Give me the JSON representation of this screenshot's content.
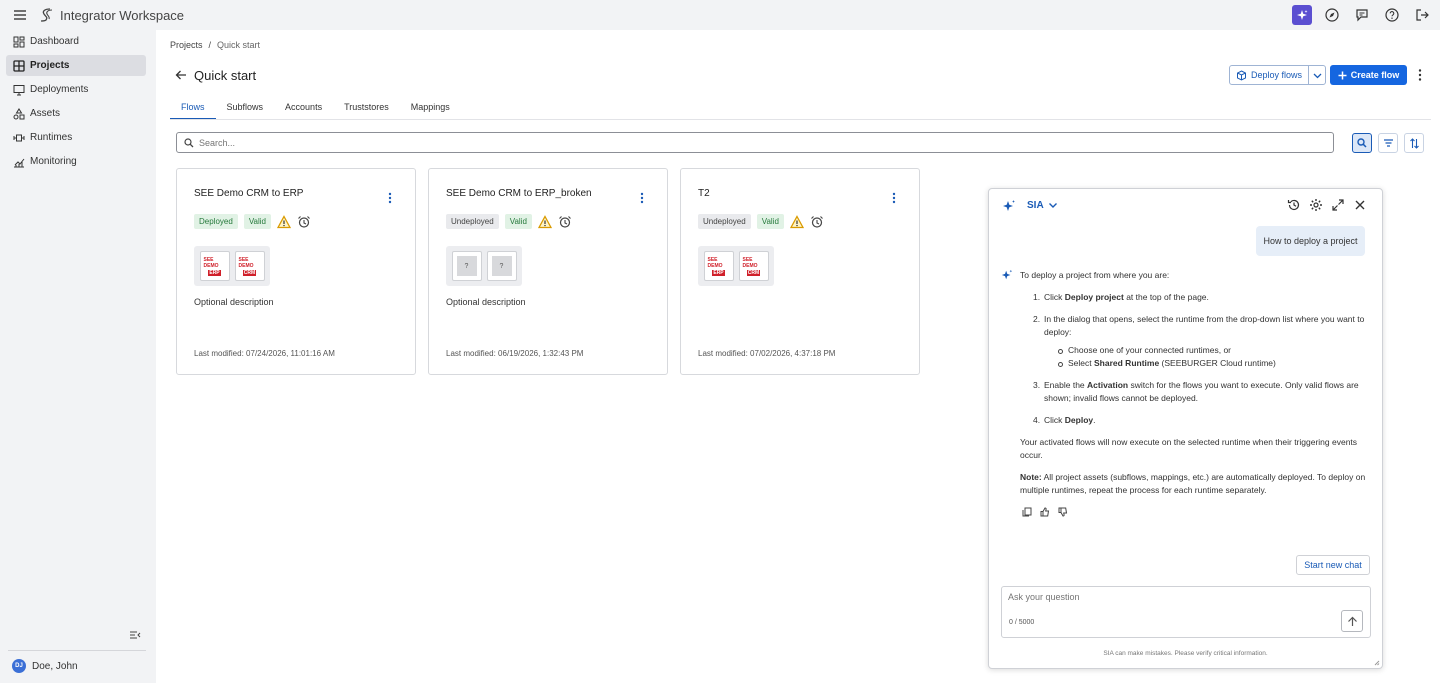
{
  "app": {
    "title": "Integrator Workspace"
  },
  "topbar": {
    "icons": [
      "menu-icon",
      "ai-sparkle-icon",
      "compass-icon",
      "chat-icon",
      "help-icon",
      "logout-icon"
    ]
  },
  "sidebar": {
    "items": [
      {
        "label": "Dashboard",
        "icon": "dashboard-icon"
      },
      {
        "label": "Projects",
        "icon": "projects-icon",
        "active": true
      },
      {
        "label": "Deployments",
        "icon": "monitor-icon"
      },
      {
        "label": "Assets",
        "icon": "assets-icon"
      },
      {
        "label": "Runtimes",
        "icon": "runtimes-icon"
      },
      {
        "label": "Monitoring",
        "icon": "chart-icon"
      }
    ],
    "user": {
      "initials": "DJ",
      "name": "Doe, John"
    }
  },
  "breadcrumb": {
    "root": "Projects",
    "sep": "/",
    "current": "Quick start"
  },
  "page": {
    "title": "Quick start"
  },
  "actions": {
    "deploy_label": "Deploy flows",
    "create_label": "Create flow"
  },
  "tabs": [
    "Flows",
    "Subflows",
    "Accounts",
    "Truststores",
    "Mappings"
  ],
  "search": {
    "placeholder": "Search..."
  },
  "cards": [
    {
      "title": "SEE Demo CRM to ERP",
      "status": "Deployed",
      "validity": "Valid",
      "desc": "Optional description",
      "modified_label": "Last modified:",
      "modified": "07/24/2026, 11:01:16 AM"
    },
    {
      "title": "SEE Demo CRM to ERP_broken",
      "status": "Undeployed",
      "validity": "Valid",
      "desc": "Optional description",
      "modified_label": "Last modified:",
      "modified": "06/19/2026, 1:32:43 PM"
    },
    {
      "title": "T2",
      "status": "Undeployed",
      "validity": "Valid",
      "desc": "",
      "modified_label": "Last modified:",
      "modified": "07/02/2026, 4:37:18 PM"
    }
  ],
  "system_icons": {
    "top": "SEE DEMO",
    "erp": "ERP",
    "crm": "CRM",
    "unknown": "?"
  },
  "sia": {
    "title": "SIA",
    "user_question": "How to deploy a project",
    "intro": "To deploy a project from where you are:",
    "steps": {
      "s1_pre": "Click ",
      "s1_bold": "Deploy project",
      "s1_post": " at the top of the page.",
      "s2": "In the dialog that opens, select the runtime from the drop-down list where you want to deploy:",
      "s2_b1": "Choose one of your connected runtimes, or",
      "s2_b2_pre": "Select ",
      "s2_b2_bold": "Shared Runtime",
      "s2_b2_post": " (SEEBURGER Cloud runtime)",
      "s3_pre": "Enable the ",
      "s3_bold": "Activation",
      "s3_post": " switch for the flows you want to execute. Only valid flows are shown; invalid flows cannot be deployed.",
      "s4_pre": "Click ",
      "s4_bold": "Deploy",
      "s4_post": "."
    },
    "after": "Your activated flows will now execute on the selected runtime when their triggering events occur.",
    "note_bold": "Note:",
    "note": " All project assets (subflows, mappings, etc.) are automatically deployed. To deploy on multiple runtimes, repeat the process for each runtime separately.",
    "new_chat": "Start new chat",
    "input_placeholder": "Ask your question",
    "counter": "0 / 5000",
    "disclaimer": "SIA can make mistakes. Please verify critical information."
  },
  "colors": {
    "primary": "#1566e0",
    "link": "#1a5bb6",
    "ai": "#5b4fd1",
    "valid_bg": "#e1f2e5",
    "warn": "#e0a100"
  }
}
